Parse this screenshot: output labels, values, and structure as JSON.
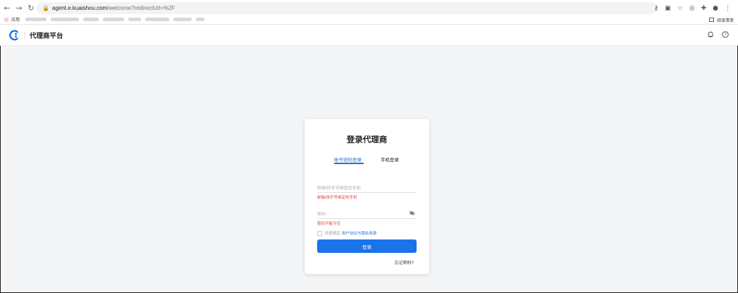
{
  "browser": {
    "url_host": "agent.e.kuaishou.com",
    "url_path": "/welcome?redirectUrl=%2F",
    "bookmark_apps_label": "应用",
    "reading_list_label": "阅读清单"
  },
  "header": {
    "title": "代理商平台"
  },
  "login": {
    "title": "登录代理商",
    "tabs": [
      {
        "label": "账号密码登录",
        "active": true
      },
      {
        "label": "手机登录",
        "active": false
      }
    ],
    "account_placeholder": "邮箱/快手号绑定的手机",
    "account_error": "邮箱/快手号绑定的手机",
    "password_placeholder": "密码",
    "password_error": "密码不能为空",
    "agree_prefix": "同意相应",
    "agree_link": "用户协议与隐私条款",
    "submit_label": "登录",
    "forgot_label": "忘记密码?"
  },
  "colors": {
    "accent": "#1a73e8",
    "error": "#e0413a",
    "page_bg": "#f4f5f7"
  }
}
